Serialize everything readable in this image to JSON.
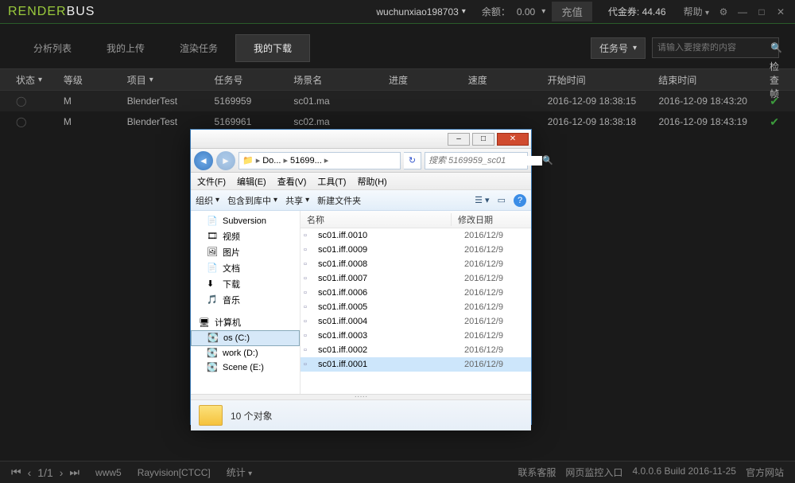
{
  "header": {
    "logo_render": "RENDER",
    "logo_bus": "BUS",
    "username": "wuchunxiao198703",
    "balance_label": "余额：",
    "balance_value": "0.00",
    "recharge": "充值",
    "voucher_label": "代金券:",
    "voucher_value": "44.46",
    "help": "帮助"
  },
  "tabs": {
    "items": [
      "分析列表",
      "我的上传",
      "渲染任务",
      "我的下载"
    ],
    "filter_label": "任务号",
    "search_placeholder": "请输入要搜索的内容"
  },
  "columns": {
    "status": "状态",
    "level": "等级",
    "project": "项目",
    "taskid": "任务号",
    "scene": "场景名",
    "progress": "进度",
    "speed": "速度",
    "start": "开始时间",
    "end": "结束时间",
    "check": "检查帧"
  },
  "rows": [
    {
      "level": "M",
      "project": "BlenderTest",
      "taskid": "5169959",
      "scene": "sc01.ma",
      "start": "2016-12-09 18:38:15",
      "end": "2016-12-09 18:43:20"
    },
    {
      "level": "M",
      "project": "BlenderTest",
      "taskid": "5169961",
      "scene": "sc02.ma",
      "start": "2016-12-09 18:38:18",
      "end": "2016-12-09 18:43:19"
    }
  ],
  "explorer": {
    "breadcrumb": [
      "Do...",
      "51699..."
    ],
    "search_placeholder": "搜索 5169959_sc01",
    "menus": [
      "文件(F)",
      "编辑(E)",
      "查看(V)",
      "工具(T)",
      "帮助(H)"
    ],
    "toolbar": {
      "org": "组织",
      "include": "包含到库中",
      "share": "共享",
      "newfolder": "新建文件夹"
    },
    "sidebar": {
      "items": [
        "Subversion",
        "视频",
        "图片",
        "文档",
        "下载",
        "音乐"
      ],
      "group": "计算机",
      "drives": [
        "os (C:)",
        "work (D:)",
        "Scene (E:)"
      ]
    },
    "list": {
      "col_name": "名称",
      "col_date": "修改日期",
      "files": [
        {
          "name": "sc01.iff.0010",
          "date": "2016/12/9"
        },
        {
          "name": "sc01.iff.0009",
          "date": "2016/12/9"
        },
        {
          "name": "sc01.iff.0008",
          "date": "2016/12/9"
        },
        {
          "name": "sc01.iff.0007",
          "date": "2016/12/9"
        },
        {
          "name": "sc01.iff.0006",
          "date": "2016/12/9"
        },
        {
          "name": "sc01.iff.0005",
          "date": "2016/12/9"
        },
        {
          "name": "sc01.iff.0004",
          "date": "2016/12/9"
        },
        {
          "name": "sc01.iff.0003",
          "date": "2016/12/9"
        },
        {
          "name": "sc01.iff.0002",
          "date": "2016/12/9"
        },
        {
          "name": "sc01.iff.0001",
          "date": "2016/12/9"
        }
      ]
    },
    "status": "10 个对象"
  },
  "footer": {
    "page": "1/1",
    "server": "www5",
    "isp": "Rayvision[CTCC]",
    "stats": "统计",
    "contact": "联系客服",
    "monitor": "网页监控入口",
    "build": "4.0.0.6 Build 2016-11-25",
    "site": "官方网站"
  }
}
